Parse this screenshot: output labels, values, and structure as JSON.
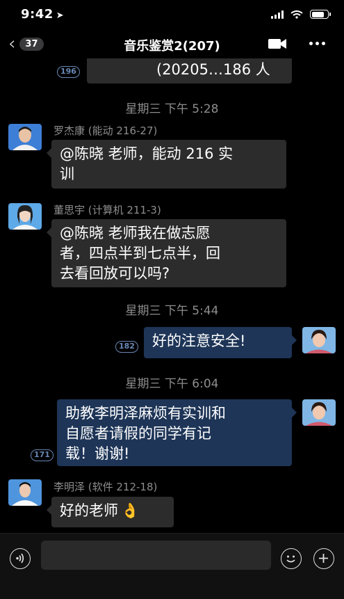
{
  "status_bar": {
    "time": "9:42",
    "battery_level": 0.85
  },
  "nav": {
    "unread_count": "37",
    "title": "音乐鉴赏2(207)",
    "back_icon": "chevron-left-icon",
    "video_icon": "video-call-icon",
    "more_icon": "more-dots-icon"
  },
  "messages": {
    "partial_top": {
      "text": "(20205…186 人",
      "read_count": "196"
    },
    "ts1": "星期三 下午 5:28",
    "m1": {
      "sender": "罗杰康 (能动 216-27)",
      "line1": "@陈晓 老师，能动 216 实",
      "line2": "训"
    },
    "m2": {
      "sender": "董思宇 (计算机 211-3)",
      "line1": "@陈晓 老师我在做志愿",
      "line2": "者，四点半到七点半，回",
      "line3": "去看回放可以吗?"
    },
    "ts2": "星期三 下午 5:44",
    "m3": {
      "text": "好的注意安全!",
      "read_count": "182"
    },
    "ts3": "星期三 下午 6:04",
    "m4": {
      "line1": "助教李明泽麻烦有实训和",
      "line2": "自愿者请假的同学有记",
      "line3": "载！谢谢!",
      "read_count": "171"
    },
    "m5": {
      "sender": "李明泽 (软件 212-18)",
      "text": "好的老师",
      "emoji": "👌"
    }
  },
  "input_bar": {
    "voice_icon": "voice-icon",
    "emoji_icon": "emoji-icon",
    "plus_icon": "plus-icon"
  },
  "colors": {
    "background": "#000000",
    "bubble_other": "#2c2c2c",
    "bubble_mine": "#1e3557",
    "read_badge": "#6a88b5",
    "meta_text": "#8d8d8d"
  }
}
